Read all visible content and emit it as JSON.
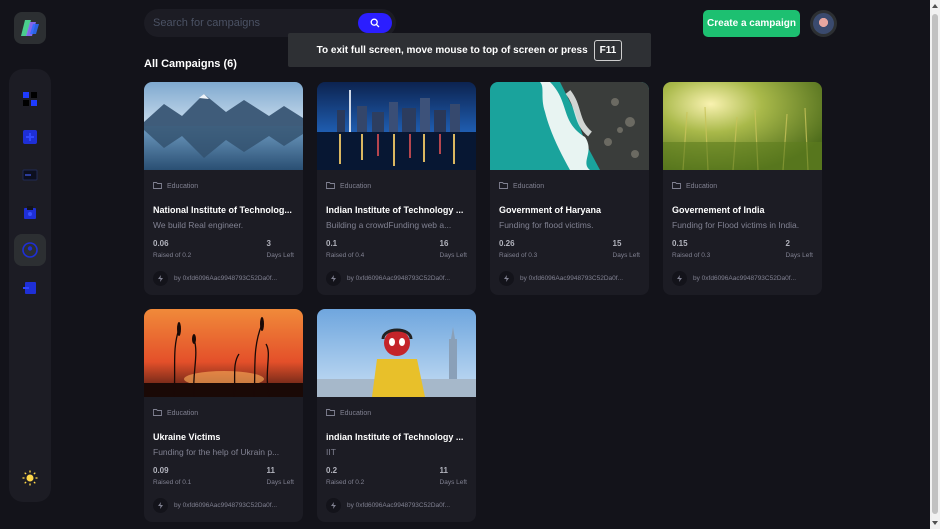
{
  "search": {
    "placeholder": "Search for campaigns",
    "icon": "search-icon"
  },
  "header": {
    "create_label": "Create a campaign"
  },
  "banner": {
    "text": "To exit full screen, move mouse to top of screen or press",
    "key": "F11"
  },
  "section": {
    "title": "All Campaigns (6)"
  },
  "sidebar": {
    "items": [
      {
        "name": "dashboard",
        "icon": "dashboard-icon",
        "active": false
      },
      {
        "name": "create-campaign",
        "icon": "create-campaign-icon",
        "active": false
      },
      {
        "name": "payment",
        "icon": "payment-icon",
        "active": false
      },
      {
        "name": "withdraw",
        "icon": "withdraw-icon",
        "active": false
      },
      {
        "name": "profile",
        "icon": "profile-icon",
        "active": true
      },
      {
        "name": "logout",
        "icon": "logout-icon",
        "active": false
      }
    ],
    "theme_icon": "sun-icon"
  },
  "campaigns": [
    {
      "category": "Education",
      "title": "National Institute of Technolog...",
      "description": "We build Real engineer.",
      "raised": "0.06",
      "raised_label": "Raised of 0.2",
      "days": "3",
      "days_label": "Days Left",
      "owner": "by 0xfd6096Aac9948793C52Da0f...",
      "image": "mountain-lake"
    },
    {
      "category": "Education",
      "title": "Indian Institute of Technology ...",
      "description": "Building a crowdFunding web a...",
      "raised": "0.1",
      "raised_label": "Raised of 0.4",
      "days": "16",
      "days_label": "Days Left",
      "owner": "by 0xfd6096Aac9948793C52Da0f...",
      "image": "city-night"
    },
    {
      "category": "Education",
      "title": "Government of Haryana",
      "description": "Funding for flood victims.",
      "raised": "0.26",
      "raised_label": "Raised of 0.3",
      "days": "15",
      "days_label": "Days Left",
      "owner": "by 0xfd6096Aac9948793C52Da0f...",
      "image": "coast-waves"
    },
    {
      "category": "Education",
      "title": "Governement of India",
      "description": "Funding for Flood victims in India.",
      "raised": "0.15",
      "raised_label": "Raised of 0.3",
      "days": "2",
      "days_label": "Days Left",
      "owner": "by 0xfd6096Aac9948793C52Da0f...",
      "image": "wheat-field"
    },
    {
      "category": "Education",
      "title": "Ukraine Victims",
      "description": "Funding for the help of Ukrain p...",
      "raised": "0.09",
      "raised_label": "Raised of 0.1",
      "days": "11",
      "days_label": "Days Left",
      "owner": "by 0xfd6096Aac9948793C52Da0f...",
      "image": "sunset-reeds"
    },
    {
      "category": "Education",
      "title": "indian Institute of Technology ...",
      "description": "IIT",
      "raised": "0.2",
      "raised_label": "Raised of 0.2",
      "days": "11",
      "days_label": "Days Left",
      "owner": "by 0xfd6096Aac9948793C52Da0f...",
      "image": "spiderman-city"
    }
  ],
  "colors": {
    "accent_green": "#1dc071",
    "accent_blue": "#2b1eff",
    "bg": "#13131a",
    "card": "#1c1c24",
    "muted": "#808191"
  }
}
